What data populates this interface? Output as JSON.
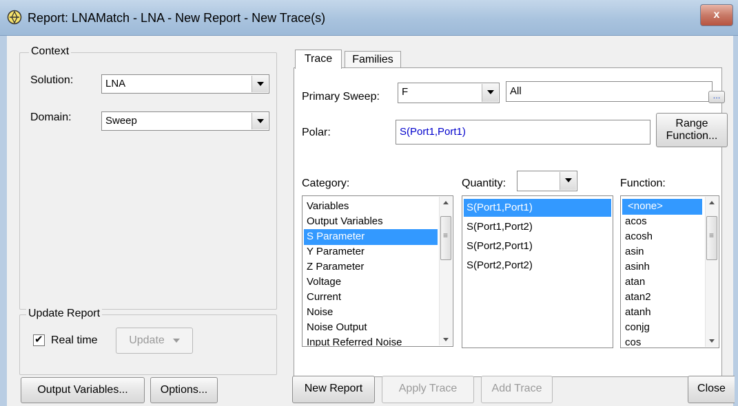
{
  "window": {
    "title": "Report: LNAMatch - LNA - New Report - New Trace(s)",
    "close_label": "x"
  },
  "context": {
    "legend": "Context",
    "solution_label": "Solution:",
    "solution_value": "LNA",
    "domain_label": "Domain:",
    "domain_value": "Sweep"
  },
  "update_report": {
    "legend": "Update Report",
    "realtime_label": "Real time",
    "realtime_checked": true,
    "update_label": "Update"
  },
  "tabs": [
    {
      "label": "Trace",
      "active": true
    },
    {
      "label": "Families",
      "active": false
    }
  ],
  "trace": {
    "primary_sweep_label": "Primary Sweep:",
    "primary_sweep_value": "F",
    "sweep_range_value": "All",
    "ellipsis_label": "...",
    "polar_label": "Polar:",
    "polar_value": "S(Port1,Port1)",
    "range_function_line1": "Range",
    "range_function_line2": "Function...",
    "category_label": "Category:",
    "quantity_label": "Quantity:",
    "quantity_filter_value": "",
    "function_label": "Function:",
    "categories": [
      "Variables",
      "Output Variables",
      "S Parameter",
      "Y Parameter",
      "Z Parameter",
      "Voltage",
      "Current",
      "Noise",
      "Noise Output",
      "Input Referred Noise"
    ],
    "selected_category": "S Parameter",
    "quantities": [
      "S(Port1,Port1)",
      "S(Port1,Port2)",
      "S(Port2,Port1)",
      "S(Port2,Port2)"
    ],
    "selected_quantity": "S(Port1,Port1)",
    "functions": [
      "<none>",
      "acos",
      "acosh",
      "asin",
      "asinh",
      "atan",
      "atan2",
      "atanh",
      "conjg",
      "cos"
    ],
    "selected_function": "<none>"
  },
  "buttons": {
    "output_variables": "Output Variables...",
    "options": "Options...",
    "new_report": "New Report",
    "apply_trace": "Apply Trace",
    "add_trace": "Add Trace",
    "close": "Close"
  },
  "colors": {
    "selection": "#3399ff",
    "quantity_text": "#0000cc",
    "title_bar": "#a9c3de"
  }
}
